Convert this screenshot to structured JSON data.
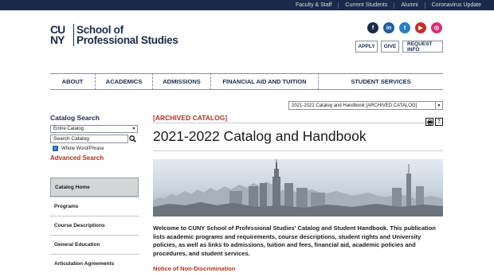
{
  "top_links": [
    "Faculty & Staff",
    "Current Students",
    "Alumni",
    "Coronavirus Update"
  ],
  "logo": {
    "mark_line1": "CU",
    "mark_line2": "NY",
    "text_line1": "School of",
    "text_line2": "Professional Studies"
  },
  "social": [
    {
      "name": "facebook-icon",
      "glyph": "f"
    },
    {
      "name": "linkedin-icon",
      "glyph": "in"
    },
    {
      "name": "twitter-icon",
      "glyph": "t"
    },
    {
      "name": "youtube-icon",
      "glyph": "▶"
    },
    {
      "name": "instagram-icon",
      "glyph": "◎"
    }
  ],
  "actions": {
    "apply": "APPLY",
    "give": "GIVE",
    "request_info": "REQUEST INFO"
  },
  "nav": [
    "ABOUT",
    "ACADEMICS",
    "ADMISSIONS",
    "FINANCIAL AID AND TUITION",
    "STUDENT SERVICES"
  ],
  "catalog_select": "2021-2022 Catalog and Handbook [ARCHIVED CATALOG]",
  "sidebar": {
    "title": "Catalog Search",
    "scope": "Entire Catalog",
    "search_placeholder": "Search Catalog",
    "whole_word_label": "Whole Word/Phrase",
    "advanced_search": "Advanced Search"
  },
  "menu": [
    "Catalog Home",
    "Programs",
    "Course Descriptions",
    "General Education",
    "Articulation Agreements"
  ],
  "main": {
    "archived_label": "[ARCHIVED CATALOG]",
    "title": "2021-2022 Catalog and Handbook",
    "intro": "Welcome to CUNY School of Professional Studies' Catalog and Student Handbook. This publication lists academic programs and requirements, course descriptions, student rights and University policies, as well as links to admissions, tuition and fees, financial aid, academic policies and procedures, and student services.",
    "notice": "Notice of Non-Discrimination"
  },
  "colors": {
    "navy": "#1b2a4a",
    "accent_red": "#b0351f",
    "active_menu": "#d3d5d8"
  }
}
